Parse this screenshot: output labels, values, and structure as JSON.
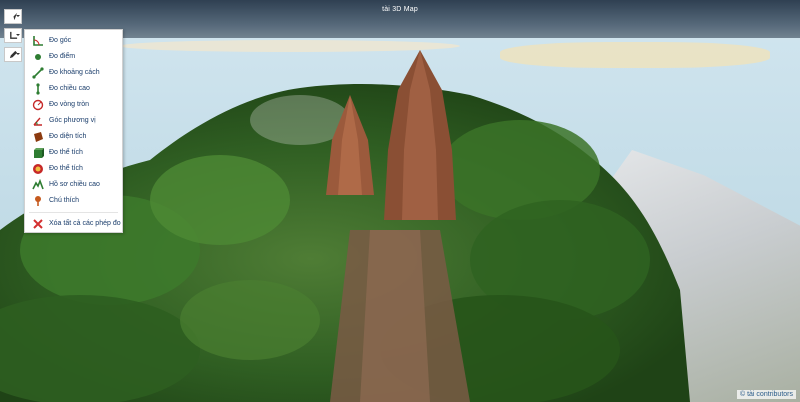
{
  "app": {
    "title": "tài 3D Map"
  },
  "toolbar": {
    "buttons": [
      {
        "name": "navigate-tool",
        "icon": "arrow-cursor-icon"
      },
      {
        "name": "measure-tool",
        "icon": "angle-ruler-icon"
      },
      {
        "name": "edit-tool",
        "icon": "pencil-icon"
      }
    ]
  },
  "measure_menu": {
    "items": [
      {
        "label": "Đo góc",
        "icon": "angle-icon",
        "color": "#2e7d32"
      },
      {
        "label": "Đo điểm",
        "icon": "point-icon",
        "color": "#2e7d32"
      },
      {
        "label": "Đo khoảng cách",
        "icon": "distance-icon",
        "color": "#2e7d32"
      },
      {
        "label": "Đo chiều cao",
        "icon": "height-icon",
        "color": "#2e7d32"
      },
      {
        "label": "Đo vòng tròn",
        "icon": "circle-icon",
        "color": "#c62828"
      },
      {
        "label": "Góc phương vị",
        "icon": "azimuth-icon",
        "color": "#c62828"
      },
      {
        "label": "Đo diện tích",
        "icon": "area-icon",
        "color": "#8b3a0f"
      },
      {
        "label": "Đo thể tích",
        "icon": "volume-box-icon",
        "color": "#2e7d32"
      },
      {
        "label": "Đo thể tích",
        "icon": "volume-sphere-icon",
        "color": "#c62828"
      },
      {
        "label": "Hồ sơ chiều cao",
        "icon": "profile-icon",
        "color": "#2e7d32"
      },
      {
        "label": "Chú thích",
        "icon": "annotation-icon",
        "color": "#c65a1e"
      }
    ],
    "clear_label": "Xóa tất cả các phép đo",
    "clear_icon": "clear-x-icon",
    "clear_color": "#d32f2f"
  },
  "footer": {
    "attribution": "© tài contributors"
  }
}
